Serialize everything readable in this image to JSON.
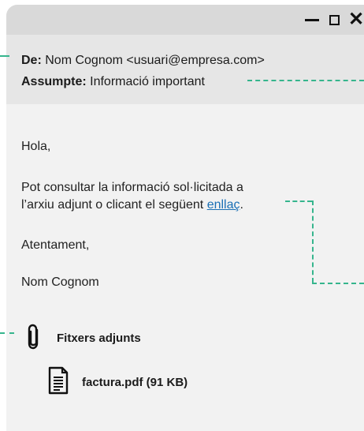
{
  "window": {
    "controls": {
      "minimize": "minimize",
      "maximize": "maximize",
      "close": "close"
    }
  },
  "email": {
    "from_label": "De:",
    "from_value": "Nom Cognom <usuari@empresa.com>",
    "subject_label": "Assumpte:",
    "subject_value": "Informació important",
    "greeting": "Hola,",
    "line1": "Pot consultar la informació sol·licitada a",
    "line2_prefix": "l’arxiu adjunt o clicant el següent ",
    "link_text": "enllaç",
    "line2_suffix": ".",
    "closing": "Atentament,",
    "signature": "Nom Cognom"
  },
  "attachments": {
    "title": "Fitxers adjunts",
    "file": "factura.pdf (91 KB)"
  },
  "colors": {
    "titlebar": "#d9d9d9",
    "header": "#e6e6e6",
    "body": "#f2f2f2",
    "annotation_dash": "#36b58d",
    "link": "#1a6fb5"
  },
  "icons": [
    "minimize-icon",
    "maximize-icon",
    "close-icon",
    "paperclip-icon",
    "document-icon"
  ]
}
